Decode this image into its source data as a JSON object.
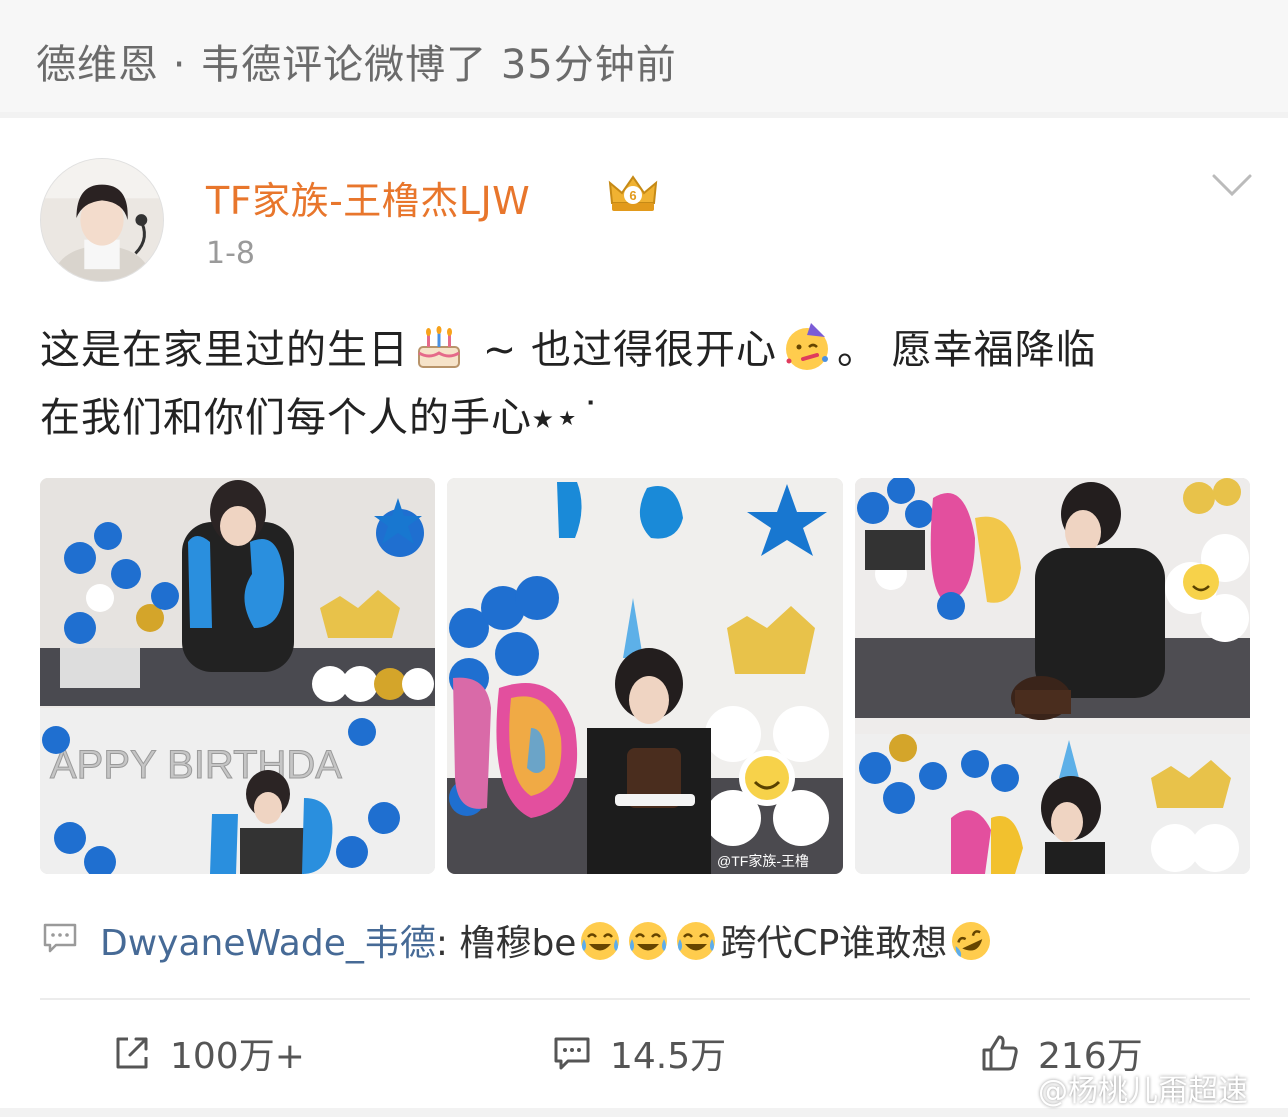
{
  "notice": {
    "text": "德维恩 · 韦德评论微博了 35分钟前"
  },
  "post": {
    "username": "TF家族-王橹杰LJW",
    "date": "1-8",
    "text_part1": "这是在家里过的生日",
    "text_part2": " ~ 也过得很开心",
    "text_part3": "。 愿幸福降临",
    "text_part4": "在我们和你们每个人的手心⭑⋆˙",
    "emoji_1": "birthday-cake",
    "emoji_2": "partying-face",
    "photos": [
      {
        "name": "photo-1"
      },
      {
        "name": "photo-2",
        "watermark": "@TF家族-王橹"
      },
      {
        "name": "photo-3"
      }
    ]
  },
  "comment_preview": {
    "author": "DwyaneWade_韦德",
    "separator": ": ",
    "text1": "橹穆be",
    "text2": "跨代CP谁敢想",
    "emoji": "tears-of-joy"
  },
  "actions": {
    "share_count": "100万+",
    "comment_count": "14.5万",
    "like_count": "216万"
  },
  "watermark": "@杨桃儿甭超速",
  "colors": {
    "username": "#e8762c",
    "comment_author": "#466a96",
    "muted": "#9a9a9a"
  }
}
